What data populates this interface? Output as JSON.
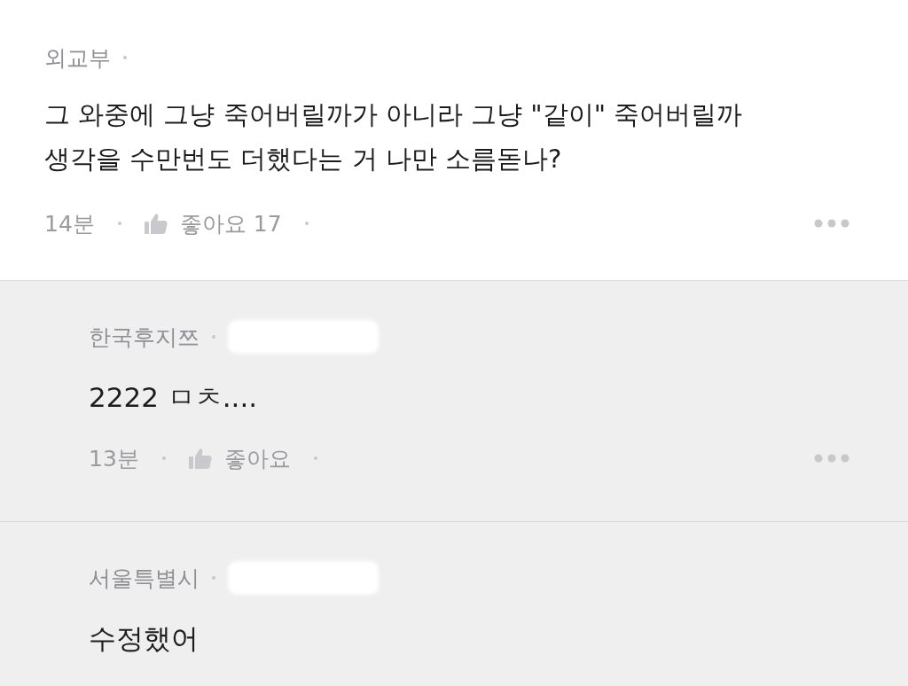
{
  "comments": [
    {
      "kind": "main",
      "author": "외교부",
      "body": "그 와중에 그냥 죽어버릴까가 아니라 그냥 \"같이\" 죽어버릴까 생각을 수만번도 더했다는 거 나만 소름돋나?",
      "time": "14분",
      "like_label": "좋아요",
      "like_count": "17"
    },
    {
      "kind": "reply",
      "author": "한국후지쯔",
      "body": "2222 ㅁㅊ....",
      "time": "13분",
      "like_label": "좋아요"
    },
    {
      "kind": "reply",
      "author": "서울특별시",
      "body": "수정했어"
    }
  ]
}
